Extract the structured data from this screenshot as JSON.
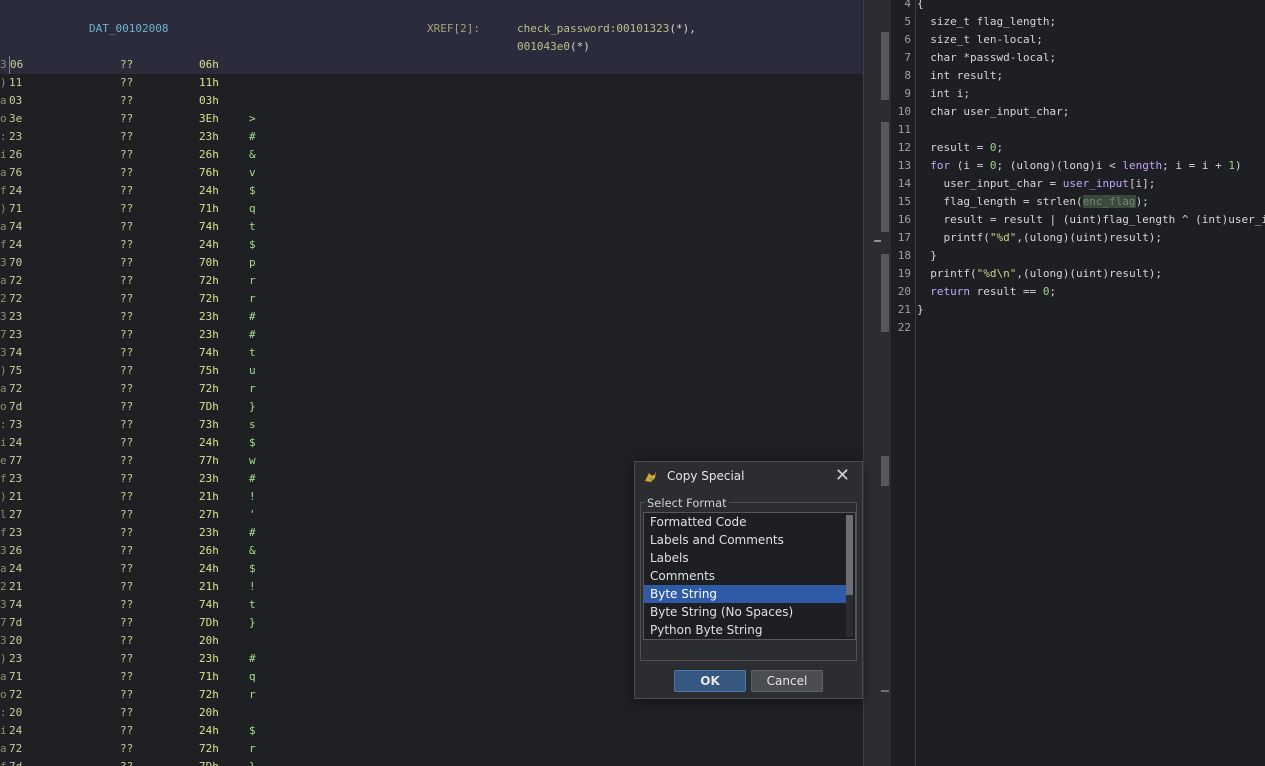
{
  "listing": {
    "label": "DAT_00102008",
    "xref_label": "XREF[2]:",
    "xref_lines": [
      {
        "ref": "check_password:00101323",
        "suffix": "(*),"
      },
      {
        "ref": "001043e0",
        "suffix": "(*)"
      }
    ],
    "rows": [
      {
        "addr": "3",
        "byte": "06",
        "q": "??",
        "hex": "06h",
        "chr": ""
      },
      {
        "addr": ")",
        "byte": "11",
        "q": "??",
        "hex": "11h",
        "chr": ""
      },
      {
        "addr": "a",
        "byte": "03",
        "q": "??",
        "hex": "03h",
        "chr": ""
      },
      {
        "addr": "o",
        "byte": "3e",
        "q": "??",
        "hex": "3Eh",
        "chr": ">"
      },
      {
        "addr": ":",
        "byte": "23",
        "q": "??",
        "hex": "23h",
        "chr": "#"
      },
      {
        "addr": "i",
        "byte": "26",
        "q": "??",
        "hex": "26h",
        "chr": "&"
      },
      {
        "addr": "a",
        "byte": "76",
        "q": "??",
        "hex": "76h",
        "chr": "v"
      },
      {
        "addr": "f",
        "byte": "24",
        "q": "??",
        "hex": "24h",
        "chr": "$"
      },
      {
        "addr": ")",
        "byte": "71",
        "q": "??",
        "hex": "71h",
        "chr": "q"
      },
      {
        "addr": "a",
        "byte": "74",
        "q": "??",
        "hex": "74h",
        "chr": "t"
      },
      {
        "addr": "f",
        "byte": "24",
        "q": "??",
        "hex": "24h",
        "chr": "$"
      },
      {
        "addr": "3",
        "byte": "70",
        "q": "??",
        "hex": "70h",
        "chr": "p"
      },
      {
        "addr": "a",
        "byte": "72",
        "q": "??",
        "hex": "72h",
        "chr": "r"
      },
      {
        "addr": "2",
        "byte": "72",
        "q": "??",
        "hex": "72h",
        "chr": "r"
      },
      {
        "addr": "3",
        "byte": "23",
        "q": "??",
        "hex": "23h",
        "chr": "#"
      },
      {
        "addr": "7",
        "byte": "23",
        "q": "??",
        "hex": "23h",
        "chr": "#"
      },
      {
        "addr": "3",
        "byte": "74",
        "q": "??",
        "hex": "74h",
        "chr": "t"
      },
      {
        "addr": ")",
        "byte": "75",
        "q": "??",
        "hex": "75h",
        "chr": "u"
      },
      {
        "addr": "a",
        "byte": "72",
        "q": "??",
        "hex": "72h",
        "chr": "r"
      },
      {
        "addr": "o",
        "byte": "7d",
        "q": "??",
        "hex": "7Dh",
        "chr": "}"
      },
      {
        "addr": ":",
        "byte": "73",
        "q": "??",
        "hex": "73h",
        "chr": "s"
      },
      {
        "addr": "i",
        "byte": "24",
        "q": "??",
        "hex": "24h",
        "chr": "$"
      },
      {
        "addr": "e",
        "byte": "77",
        "q": "??",
        "hex": "77h",
        "chr": "w"
      },
      {
        "addr": "f",
        "byte": "23",
        "q": "??",
        "hex": "23h",
        "chr": "#"
      },
      {
        "addr": ")",
        "byte": "21",
        "q": "??",
        "hex": "21h",
        "chr": "!"
      },
      {
        "addr": "l",
        "byte": "27",
        "q": "??",
        "hex": "27h",
        "chr": "'"
      },
      {
        "addr": "f",
        "byte": "23",
        "q": "??",
        "hex": "23h",
        "chr": "#"
      },
      {
        "addr": "3",
        "byte": "26",
        "q": "??",
        "hex": "26h",
        "chr": "&"
      },
      {
        "addr": "a",
        "byte": "24",
        "q": "??",
        "hex": "24h",
        "chr": "$"
      },
      {
        "addr": "2",
        "byte": "21",
        "q": "??",
        "hex": "21h",
        "chr": "!"
      },
      {
        "addr": "3",
        "byte": "74",
        "q": "??",
        "hex": "74h",
        "chr": "t"
      },
      {
        "addr": "7",
        "byte": "7d",
        "q": "??",
        "hex": "7Dh",
        "chr": "}"
      },
      {
        "addr": "3",
        "byte": "20",
        "q": "??",
        "hex": "20h",
        "chr": ""
      },
      {
        "addr": ")",
        "byte": "23",
        "q": "??",
        "hex": "23h",
        "chr": "#"
      },
      {
        "addr": "a",
        "byte": "71",
        "q": "??",
        "hex": "71h",
        "chr": "q"
      },
      {
        "addr": "o",
        "byte": "72",
        "q": "??",
        "hex": "72h",
        "chr": "r"
      },
      {
        "addr": ":",
        "byte": "20",
        "q": "??",
        "hex": "20h",
        "chr": ""
      },
      {
        "addr": "i",
        "byte": "24",
        "q": "??",
        "hex": "24h",
        "chr": "$"
      },
      {
        "addr": "a",
        "byte": "72",
        "q": "??",
        "hex": "72h",
        "chr": "r"
      },
      {
        "addr": "f",
        "byte": "7d",
        "q": "??",
        "hex": "7Dh",
        "chr": "}"
      }
    ]
  },
  "decompiler": {
    "lines": [
      {
        "n": "4",
        "t": [
          [
            "{",
            "ty"
          ]
        ]
      },
      {
        "n": "5",
        "t": [
          [
            "  size_t flag_length;",
            "ty"
          ]
        ]
      },
      {
        "n": "6",
        "t": [
          [
            "  size_t len-local;",
            "ty"
          ]
        ]
      },
      {
        "n": "7",
        "t": [
          [
            "  char *passwd-local;",
            "ty"
          ]
        ]
      },
      {
        "n": "8",
        "t": [
          [
            "  int result;",
            "ty"
          ]
        ]
      },
      {
        "n": "9",
        "t": [
          [
            "  int i;",
            "ty"
          ]
        ]
      },
      {
        "n": "10",
        "t": [
          [
            "  char user_input_char;",
            "ty"
          ]
        ]
      },
      {
        "n": "11",
        "t": []
      },
      {
        "n": "12",
        "t": [
          [
            "  result = ",
            "ty"
          ],
          [
            "0",
            "num"
          ],
          [
            ";",
            "ty"
          ]
        ]
      },
      {
        "n": "13",
        "t": [
          [
            "  ",
            "ty"
          ],
          [
            "for",
            "kw"
          ],
          [
            " (i = ",
            "ty"
          ],
          [
            "0",
            "num"
          ],
          [
            "; (ulong)(long)i < ",
            "ty"
          ],
          [
            "length",
            "kw"
          ],
          [
            "; i = i + ",
            "ty"
          ],
          [
            "1",
            "num"
          ],
          [
            ")",
            "ty"
          ]
        ]
      },
      {
        "n": "14",
        "t": [
          [
            "    user_input_char = ",
            "ty"
          ],
          [
            "user_input",
            "kw"
          ],
          [
            "[i];",
            "ty"
          ]
        ]
      },
      {
        "n": "15",
        "t": [
          [
            "    flag_length = strlen(",
            "ty"
          ],
          [
            "enc_flag",
            "hl"
          ],
          [
            ");",
            "ty"
          ]
        ]
      },
      {
        "n": "16",
        "t": [
          [
            "    result = result | (uint)flag_length ^ (int)user_input_char;",
            "ty"
          ]
        ]
      },
      {
        "n": "17",
        "t": [
          [
            "    printf(",
            "ty"
          ],
          [
            "\"%d\"",
            "str"
          ],
          [
            ",(ulong)(uint)result);",
            "ty"
          ]
        ]
      },
      {
        "n": "18",
        "t": [
          [
            "  }",
            "ty"
          ]
        ]
      },
      {
        "n": "19",
        "t": [
          [
            "  printf(",
            "ty"
          ],
          [
            "\"%d\\n\"",
            "str"
          ],
          [
            ",(ulong)(uint)result);",
            "ty"
          ]
        ]
      },
      {
        "n": "20",
        "t": [
          [
            "  ",
            "ty"
          ],
          [
            "return",
            "kw"
          ],
          [
            " result == ",
            "ty"
          ],
          [
            "0",
            "num"
          ],
          [
            ";",
            "ty"
          ]
        ]
      },
      {
        "n": "21",
        "t": [
          [
            "}",
            "ty"
          ]
        ]
      },
      {
        "n": "22",
        "t": []
      }
    ]
  },
  "dialog": {
    "title": "Copy Special",
    "group_label": "Select Format",
    "options": [
      "Formatted Code",
      "Labels and Comments",
      "Labels",
      "Comments",
      "Byte String",
      "Byte String (No Spaces)",
      "Python Byte String"
    ],
    "selected_index": 4,
    "ok_label": "OK",
    "cancel_label": "Cancel",
    "close_icon": "close-icon",
    "app_icon": "ghidra-dragon-icon"
  }
}
